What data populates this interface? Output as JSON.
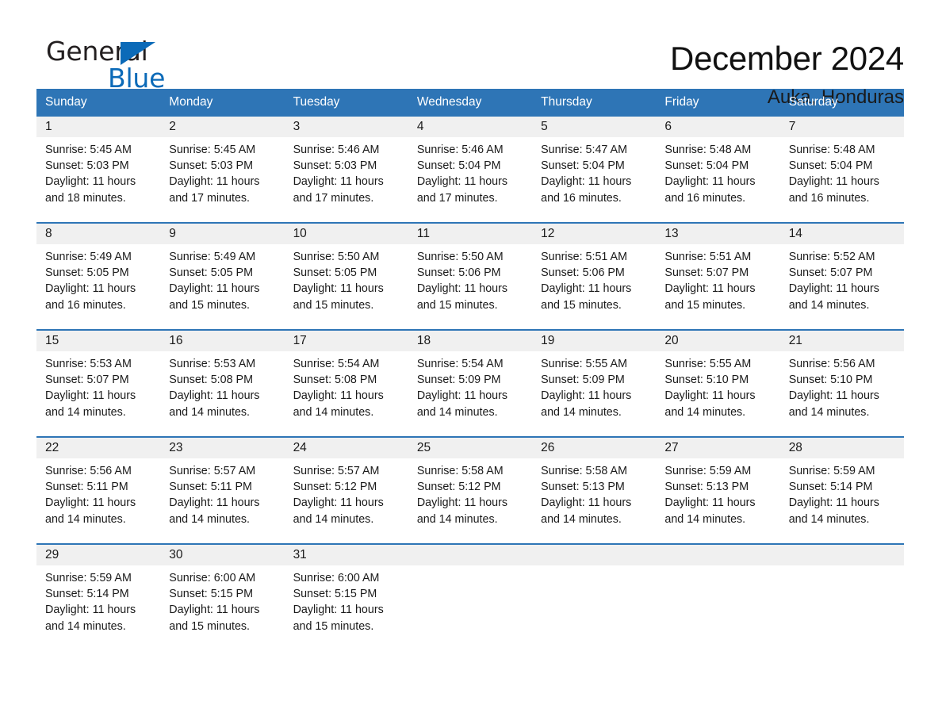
{
  "brand": {
    "name_part1": "General",
    "name_part2": "Blue",
    "triangle_color": "#0b6ab8"
  },
  "header": {
    "title": "December 2024",
    "subtitle": "Auka, Honduras"
  },
  "theme": {
    "header_blue": "#2e75b6",
    "row_divider_blue": "#2e75b6",
    "daynum_band_gray": "#f0f0f0",
    "page_background": "#ffffff",
    "text_color": "#1a1a1a"
  },
  "calendar": {
    "weekday_headers": [
      "Sunday",
      "Monday",
      "Tuesday",
      "Wednesday",
      "Thursday",
      "Friday",
      "Saturday"
    ],
    "weeks": [
      [
        {
          "day": "1",
          "sunrise": "Sunrise: 5:45 AM",
          "sunset": "Sunset: 5:03 PM",
          "daylight_line1": "Daylight: 11 hours",
          "daylight_line2": "and 18 minutes."
        },
        {
          "day": "2",
          "sunrise": "Sunrise: 5:45 AM",
          "sunset": "Sunset: 5:03 PM",
          "daylight_line1": "Daylight: 11 hours",
          "daylight_line2": "and 17 minutes."
        },
        {
          "day": "3",
          "sunrise": "Sunrise: 5:46 AM",
          "sunset": "Sunset: 5:03 PM",
          "daylight_line1": "Daylight: 11 hours",
          "daylight_line2": "and 17 minutes."
        },
        {
          "day": "4",
          "sunrise": "Sunrise: 5:46 AM",
          "sunset": "Sunset: 5:04 PM",
          "daylight_line1": "Daylight: 11 hours",
          "daylight_line2": "and 17 minutes."
        },
        {
          "day": "5",
          "sunrise": "Sunrise: 5:47 AM",
          "sunset": "Sunset: 5:04 PM",
          "daylight_line1": "Daylight: 11 hours",
          "daylight_line2": "and 16 minutes."
        },
        {
          "day": "6",
          "sunrise": "Sunrise: 5:48 AM",
          "sunset": "Sunset: 5:04 PM",
          "daylight_line1": "Daylight: 11 hours",
          "daylight_line2": "and 16 minutes."
        },
        {
          "day": "7",
          "sunrise": "Sunrise: 5:48 AM",
          "sunset": "Sunset: 5:04 PM",
          "daylight_line1": "Daylight: 11 hours",
          "daylight_line2": "and 16 minutes."
        }
      ],
      [
        {
          "day": "8",
          "sunrise": "Sunrise: 5:49 AM",
          "sunset": "Sunset: 5:05 PM",
          "daylight_line1": "Daylight: 11 hours",
          "daylight_line2": "and 16 minutes."
        },
        {
          "day": "9",
          "sunrise": "Sunrise: 5:49 AM",
          "sunset": "Sunset: 5:05 PM",
          "daylight_line1": "Daylight: 11 hours",
          "daylight_line2": "and 15 minutes."
        },
        {
          "day": "10",
          "sunrise": "Sunrise: 5:50 AM",
          "sunset": "Sunset: 5:05 PM",
          "daylight_line1": "Daylight: 11 hours",
          "daylight_line2": "and 15 minutes."
        },
        {
          "day": "11",
          "sunrise": "Sunrise: 5:50 AM",
          "sunset": "Sunset: 5:06 PM",
          "daylight_line1": "Daylight: 11 hours",
          "daylight_line2": "and 15 minutes."
        },
        {
          "day": "12",
          "sunrise": "Sunrise: 5:51 AM",
          "sunset": "Sunset: 5:06 PM",
          "daylight_line1": "Daylight: 11 hours",
          "daylight_line2": "and 15 minutes."
        },
        {
          "day": "13",
          "sunrise": "Sunrise: 5:51 AM",
          "sunset": "Sunset: 5:07 PM",
          "daylight_line1": "Daylight: 11 hours",
          "daylight_line2": "and 15 minutes."
        },
        {
          "day": "14",
          "sunrise": "Sunrise: 5:52 AM",
          "sunset": "Sunset: 5:07 PM",
          "daylight_line1": "Daylight: 11 hours",
          "daylight_line2": "and 14 minutes."
        }
      ],
      [
        {
          "day": "15",
          "sunrise": "Sunrise: 5:53 AM",
          "sunset": "Sunset: 5:07 PM",
          "daylight_line1": "Daylight: 11 hours",
          "daylight_line2": "and 14 minutes."
        },
        {
          "day": "16",
          "sunrise": "Sunrise: 5:53 AM",
          "sunset": "Sunset: 5:08 PM",
          "daylight_line1": "Daylight: 11 hours",
          "daylight_line2": "and 14 minutes."
        },
        {
          "day": "17",
          "sunrise": "Sunrise: 5:54 AM",
          "sunset": "Sunset: 5:08 PM",
          "daylight_line1": "Daylight: 11 hours",
          "daylight_line2": "and 14 minutes."
        },
        {
          "day": "18",
          "sunrise": "Sunrise: 5:54 AM",
          "sunset": "Sunset: 5:09 PM",
          "daylight_line1": "Daylight: 11 hours",
          "daylight_line2": "and 14 minutes."
        },
        {
          "day": "19",
          "sunrise": "Sunrise: 5:55 AM",
          "sunset": "Sunset: 5:09 PM",
          "daylight_line1": "Daylight: 11 hours",
          "daylight_line2": "and 14 minutes."
        },
        {
          "day": "20",
          "sunrise": "Sunrise: 5:55 AM",
          "sunset": "Sunset: 5:10 PM",
          "daylight_line1": "Daylight: 11 hours",
          "daylight_line2": "and 14 minutes."
        },
        {
          "day": "21",
          "sunrise": "Sunrise: 5:56 AM",
          "sunset": "Sunset: 5:10 PM",
          "daylight_line1": "Daylight: 11 hours",
          "daylight_line2": "and 14 minutes."
        }
      ],
      [
        {
          "day": "22",
          "sunrise": "Sunrise: 5:56 AM",
          "sunset": "Sunset: 5:11 PM",
          "daylight_line1": "Daylight: 11 hours",
          "daylight_line2": "and 14 minutes."
        },
        {
          "day": "23",
          "sunrise": "Sunrise: 5:57 AM",
          "sunset": "Sunset: 5:11 PM",
          "daylight_line1": "Daylight: 11 hours",
          "daylight_line2": "and 14 minutes."
        },
        {
          "day": "24",
          "sunrise": "Sunrise: 5:57 AM",
          "sunset": "Sunset: 5:12 PM",
          "daylight_line1": "Daylight: 11 hours",
          "daylight_line2": "and 14 minutes."
        },
        {
          "day": "25",
          "sunrise": "Sunrise: 5:58 AM",
          "sunset": "Sunset: 5:12 PM",
          "daylight_line1": "Daylight: 11 hours",
          "daylight_line2": "and 14 minutes."
        },
        {
          "day": "26",
          "sunrise": "Sunrise: 5:58 AM",
          "sunset": "Sunset: 5:13 PM",
          "daylight_line1": "Daylight: 11 hours",
          "daylight_line2": "and 14 minutes."
        },
        {
          "day": "27",
          "sunrise": "Sunrise: 5:59 AM",
          "sunset": "Sunset: 5:13 PM",
          "daylight_line1": "Daylight: 11 hours",
          "daylight_line2": "and 14 minutes."
        },
        {
          "day": "28",
          "sunrise": "Sunrise: 5:59 AM",
          "sunset": "Sunset: 5:14 PM",
          "daylight_line1": "Daylight: 11 hours",
          "daylight_line2": "and 14 minutes."
        }
      ],
      [
        {
          "day": "29",
          "sunrise": "Sunrise: 5:59 AM",
          "sunset": "Sunset: 5:14 PM",
          "daylight_line1": "Daylight: 11 hours",
          "daylight_line2": "and 14 minutes."
        },
        {
          "day": "30",
          "sunrise": "Sunrise: 6:00 AM",
          "sunset": "Sunset: 5:15 PM",
          "daylight_line1": "Daylight: 11 hours",
          "daylight_line2": "and 15 minutes."
        },
        {
          "day": "31",
          "sunrise": "Sunrise: 6:00 AM",
          "sunset": "Sunset: 5:15 PM",
          "daylight_line1": "Daylight: 11 hours",
          "daylight_line2": "and 15 minutes."
        },
        {
          "day": "",
          "sunrise": "",
          "sunset": "",
          "daylight_line1": "",
          "daylight_line2": ""
        },
        {
          "day": "",
          "sunrise": "",
          "sunset": "",
          "daylight_line1": "",
          "daylight_line2": ""
        },
        {
          "day": "",
          "sunrise": "",
          "sunset": "",
          "daylight_line1": "",
          "daylight_line2": ""
        },
        {
          "day": "",
          "sunrise": "",
          "sunset": "",
          "daylight_line1": "",
          "daylight_line2": ""
        }
      ]
    ]
  }
}
